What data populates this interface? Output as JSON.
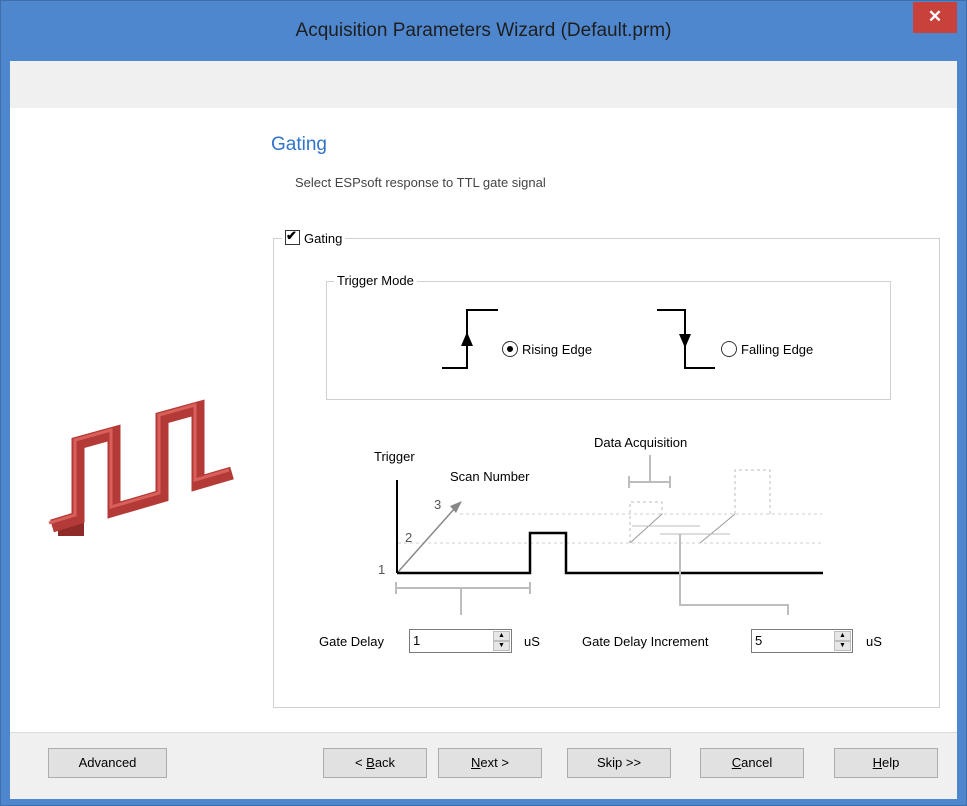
{
  "window": {
    "title": "Acquisition Parameters Wizard (Default.prm)",
    "close_glyph": "✕"
  },
  "page": {
    "heading": "Gating",
    "subheading": "Select ESPsoft response to TTL gate signal"
  },
  "gating_group": {
    "label": "Gating",
    "checked": true,
    "check_glyph": "✔"
  },
  "trigger_mode": {
    "label": "Trigger Mode",
    "options": [
      {
        "label": "Rising Edge",
        "selected": true
      },
      {
        "label": "Falling Edge",
        "selected": false
      }
    ]
  },
  "diagram": {
    "trigger_label": "Trigger",
    "scan_number_label": "Scan Number",
    "data_acquisition_label": "Data Acquisition",
    "level_1": "1",
    "level_2": "2",
    "level_3": "3"
  },
  "gate_delay": {
    "label": "Gate Delay",
    "value": "1",
    "unit": "uS"
  },
  "gate_delay_increment": {
    "label": "Gate Delay Increment",
    "value": "5",
    "unit": "uS"
  },
  "buttons": {
    "advanced": "Advanced",
    "back_prefix": "< ",
    "back_hot": "B",
    "back_rest": "ack",
    "next_hot": "N",
    "next_rest": "ext >",
    "skip": "Skip >>",
    "cancel_hot": "C",
    "cancel_rest": "ancel",
    "help_hot": "H",
    "help_rest": "elp"
  },
  "colors": {
    "title_bar": "#4f87cf",
    "close": "#c8413a",
    "heading": "#2e74c9",
    "logo_red": "#b33a36"
  },
  "icons": {
    "logo": "square-wave-logo-icon",
    "spin_up": "▲",
    "spin_down": "▼"
  }
}
